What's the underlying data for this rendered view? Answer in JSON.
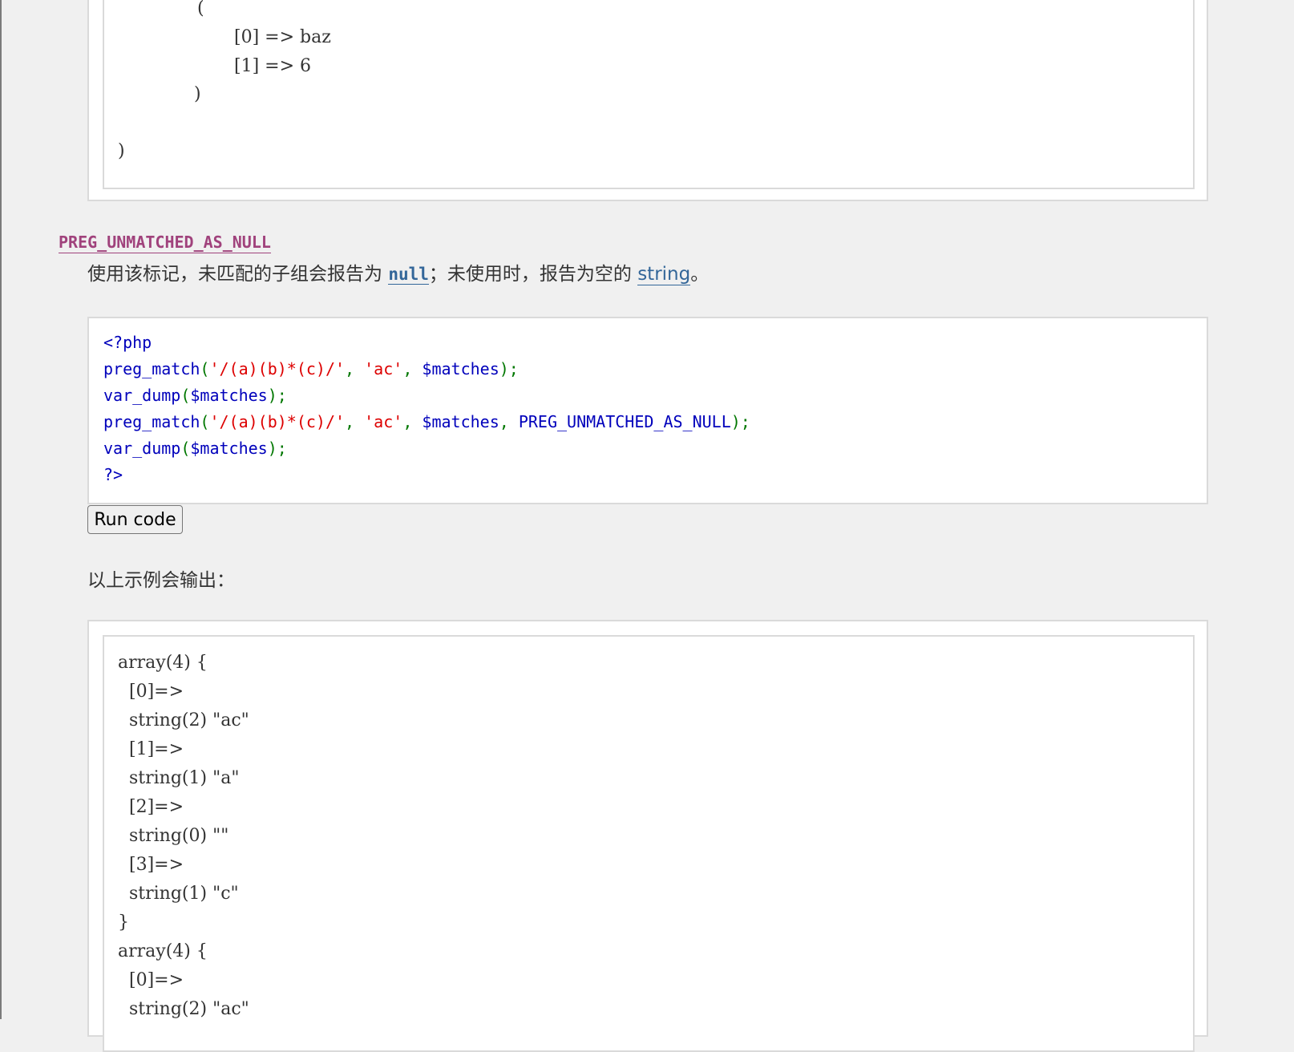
{
  "top_output": {
    "lines": [
      "(",
      "[0] => baz",
      "[1] => 6",
      ")",
      ")"
    ]
  },
  "constant": {
    "name": "PREG_UNMATCHED_AS_NULL",
    "desc_part1": "使用该标记，未匹配的子组会报告为 ",
    "null_text": "null",
    "desc_part2": "；未使用时，报告为空的 ",
    "string_link": "string",
    "desc_end": "。"
  },
  "code": {
    "line1": "<?php",
    "fn_preg_match": "preg_match",
    "fn_var_dump": "var_dump",
    "open_paren": "(",
    "regex": "'/(a)(b)*(c)/'",
    "comma": ", ",
    "subject": "'ac'",
    "var_matches": "$matches",
    "flag": "PREG_UNMATCHED_AS_NULL",
    "close": ");",
    "close_tag": "?>"
  },
  "run_button": {
    "label": "Run code"
  },
  "example_caption": "以上示例会输出：",
  "bottom_output": {
    "lines": [
      "array(4) {",
      "  [0]=>",
      "  string(2) \"ac\"",
      "  [1]=>",
      "  string(1) \"a\"",
      "  [2]=>",
      "  string(0) \"\"",
      "  [3]=>",
      "  string(1) \"c\"",
      "}",
      "array(4) {",
      "  [0]=>",
      "  string(2) \"ac\""
    ]
  }
}
